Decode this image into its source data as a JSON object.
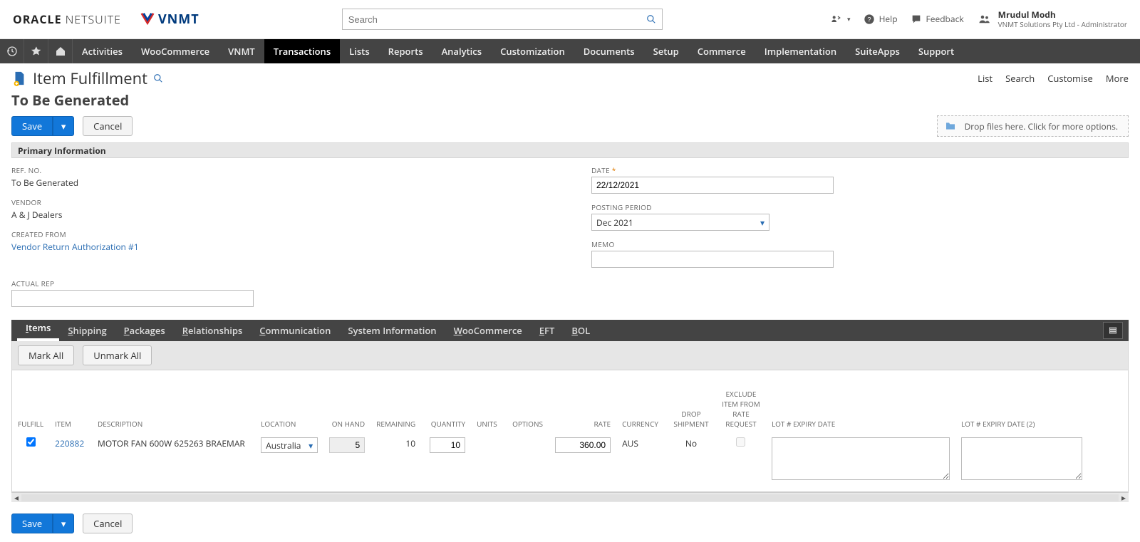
{
  "brand": {
    "oracle": "ORACLE",
    "netsuite": "NETSUITE",
    "vnmt": "VNMT"
  },
  "search": {
    "placeholder": "Search"
  },
  "help": {
    "label": "Help"
  },
  "feedback": {
    "label": "Feedback"
  },
  "user": {
    "name": "Mrudul Modh",
    "role": "VNMT Solutions Pty Ltd - Administrator"
  },
  "nav": [
    "Activities",
    "WooCommerce",
    "VNMT",
    "Transactions",
    "Lists",
    "Reports",
    "Analytics",
    "Customization",
    "Documents",
    "Setup",
    "Commerce",
    "Implementation",
    "SuiteApps",
    "Support"
  ],
  "nav_active": "Transactions",
  "page": {
    "title": "Item Fulfillment",
    "subtitle": "To Be Generated",
    "right_links": [
      "List",
      "Search",
      "Customise",
      "More"
    ]
  },
  "buttons": {
    "save": "Save",
    "cancel": "Cancel"
  },
  "dropzone": {
    "text": "Drop files here. Click for more options."
  },
  "section_primary": "Primary Information",
  "primary": {
    "ref_no": {
      "label": "REF. NO.",
      "value": "To Be Generated"
    },
    "vendor": {
      "label": "VENDOR",
      "value": "A & J Dealers"
    },
    "created_from": {
      "label": "CREATED FROM",
      "link": "Vendor Return Authorization #1"
    },
    "actual_rep": {
      "label": "ACTUAL REP",
      "value": ""
    },
    "date": {
      "label": "DATE",
      "value": "22/12/2021"
    },
    "posting_period": {
      "label": "POSTING PERIOD",
      "value": "Dec 2021"
    },
    "memo": {
      "label": "MEMO",
      "value": ""
    }
  },
  "subtabs": [
    "Items",
    "Shipping",
    "Packages",
    "Relationships",
    "Communication",
    "System Information",
    "WooCommerce",
    "EFT",
    "BOL"
  ],
  "subtab_active": "Items",
  "mark": {
    "mark_all": "Mark All",
    "unmark_all": "Unmark All"
  },
  "columns": [
    "FULFILL",
    "ITEM",
    "DESCRIPTION",
    "LOCATION",
    "ON HAND",
    "REMAINING",
    "QUANTITY",
    "UNITS",
    "OPTIONS",
    "RATE",
    "CURRENCY",
    "DROP SHIPMENT",
    "EXCLUDE ITEM FROM RATE REQUEST",
    "LOT # EXPIRY DATE",
    "LOT # EXPIRY DATE (2)"
  ],
  "rows": [
    {
      "fulfill": true,
      "item": "220882",
      "description": "MOTOR FAN 600W 625263 BRAEMAR",
      "location": "Australia",
      "on_hand": "5",
      "remaining": "10",
      "quantity": "10",
      "units": "",
      "options": "",
      "rate": "360.00",
      "currency": "AUS",
      "drop_shipment": "No",
      "exclude": false,
      "lot1": "",
      "lot2": ""
    }
  ]
}
